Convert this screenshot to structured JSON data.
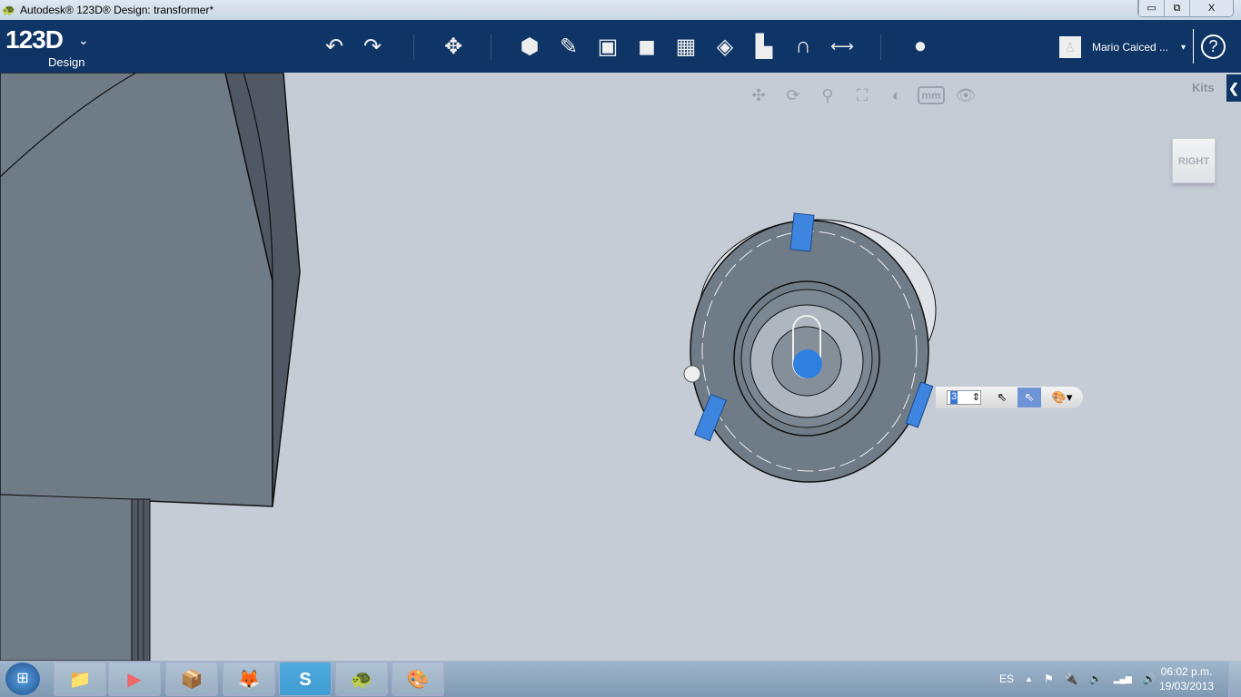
{
  "window": {
    "title": "Autodesk® 123D® Design: transformer*",
    "minimize": "▭",
    "restore": "⧉",
    "close": "X"
  },
  "toolbar": {
    "logo": "123D",
    "logo_sub": "Design",
    "logo_menu": "⌄",
    "tools": [
      {
        "name": "undo",
        "glyph": "↶"
      },
      {
        "name": "redo",
        "glyph": "↷"
      },
      {
        "name": "transform",
        "glyph": "✥"
      },
      {
        "name": "primitives",
        "glyph": "⬢"
      },
      {
        "name": "sketch",
        "glyph": "✎"
      },
      {
        "name": "construct",
        "glyph": "▣"
      },
      {
        "name": "modify",
        "glyph": "◼"
      },
      {
        "name": "pattern",
        "glyph": "▦"
      },
      {
        "name": "grouping",
        "glyph": "◈"
      },
      {
        "name": "combine",
        "glyph": "▙"
      },
      {
        "name": "snap",
        "glyph": "∩"
      },
      {
        "name": "measure",
        "glyph": "⟷"
      },
      {
        "name": "material",
        "glyph": "●"
      }
    ],
    "user": "Mario Caiced ...",
    "user_menu": "▾",
    "help": "?"
  },
  "viewport": {
    "nav": [
      {
        "name": "pan",
        "glyph": "✣"
      },
      {
        "name": "orbit",
        "glyph": "⟳"
      },
      {
        "name": "zoom",
        "glyph": "⚲"
      },
      {
        "name": "fit",
        "glyph": "⛶"
      },
      {
        "name": "visual-style",
        "glyph": "◐"
      },
      {
        "name": "units",
        "glyph": "mm"
      },
      {
        "name": "visibility",
        "glyph": "👁"
      }
    ],
    "kits": "Kits",
    "kits_toggle": "❮",
    "viewcube": "RIGHT",
    "mini_toolbar": {
      "value": "3",
      "up_down": "⇕",
      "select": "⇖",
      "select_active": "⇖",
      "material": "🎨▾"
    }
  },
  "taskbar": {
    "start": "⊞",
    "apps": [
      {
        "name": "explorer",
        "glyph": "📁"
      },
      {
        "name": "media-player",
        "glyph": "▶"
      },
      {
        "name": "archive",
        "glyph": "📦"
      },
      {
        "name": "firefox",
        "glyph": "🦊"
      },
      {
        "name": "skype",
        "glyph": "S"
      },
      {
        "name": "123d",
        "glyph": "🐢"
      },
      {
        "name": "paint",
        "glyph": "🎨"
      }
    ],
    "lang": "ES",
    "tray": [
      {
        "name": "show-hidden",
        "glyph": "▲"
      },
      {
        "name": "flag",
        "glyph": "⚑"
      },
      {
        "name": "power",
        "glyph": "🔌"
      },
      {
        "name": "speaker-muted",
        "glyph": "🔈"
      },
      {
        "name": "signal",
        "glyph": "▂▄▆"
      },
      {
        "name": "volume",
        "glyph": "🔊"
      }
    ],
    "time": "06:02 p.m.",
    "date": "19/03/2013"
  }
}
